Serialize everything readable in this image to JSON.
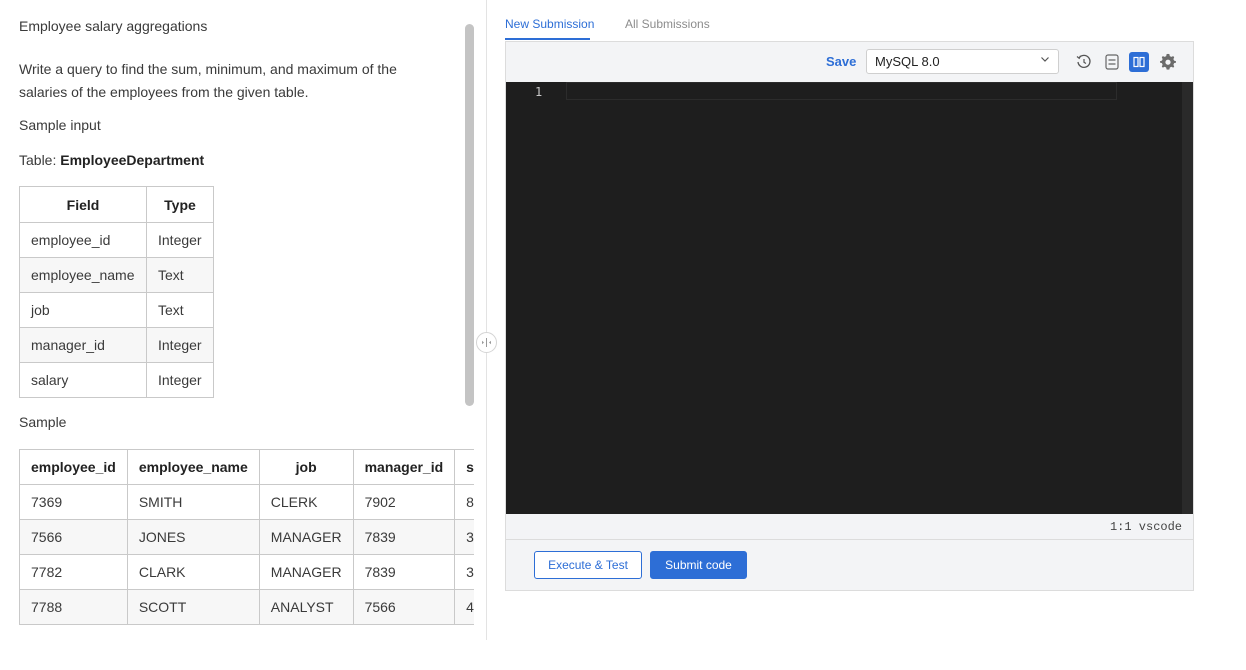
{
  "problem": {
    "title": "Employee salary aggregations",
    "description": "Write a query to find the sum, minimum, and maximum of the salaries of the employees from the given table.",
    "sample_input_label": "Sample input",
    "table_caption_prefix": "Table: ",
    "table_name": "EmployeeDepartment",
    "schema_headers": [
      "Field",
      "Type"
    ],
    "schema_rows": [
      [
        "employee_id",
        "Integer"
      ],
      [
        "employee_name",
        "Text"
      ],
      [
        "job",
        "Text"
      ],
      [
        "manager_id",
        "Integer"
      ],
      [
        "salary",
        "Integer"
      ]
    ],
    "sample_label": "Sample",
    "sample_headers": [
      "employee_id",
      "employee_name",
      "job",
      "manager_id",
      "sa"
    ],
    "sample_rows": [
      [
        "7369",
        "SMITH",
        "CLERK",
        "7902",
        "8"
      ],
      [
        "7566",
        "JONES",
        "MANAGER",
        "7839",
        "3"
      ],
      [
        "7782",
        "CLARK",
        "MANAGER",
        "7839",
        "3"
      ],
      [
        "7788",
        "SCOTT",
        "ANALYST",
        "7566",
        "4"
      ]
    ]
  },
  "tabs": [
    {
      "label": "New Submission",
      "active": true
    },
    {
      "label": "All Submissions",
      "active": false
    }
  ],
  "toolbar": {
    "save_label": "Save",
    "language": "MySQL 8.0",
    "icons": [
      "history-icon",
      "rows-layout-icon",
      "columns-layout-icon",
      "gear-icon"
    ]
  },
  "editor": {
    "line_number": "1",
    "status": "1:1 vscode"
  },
  "actions": {
    "execute_label": "Execute & Test",
    "submit_label": "Submit code"
  },
  "colors": {
    "accent": "#2d6ed6",
    "editor_bg": "#1e1e1e"
  }
}
